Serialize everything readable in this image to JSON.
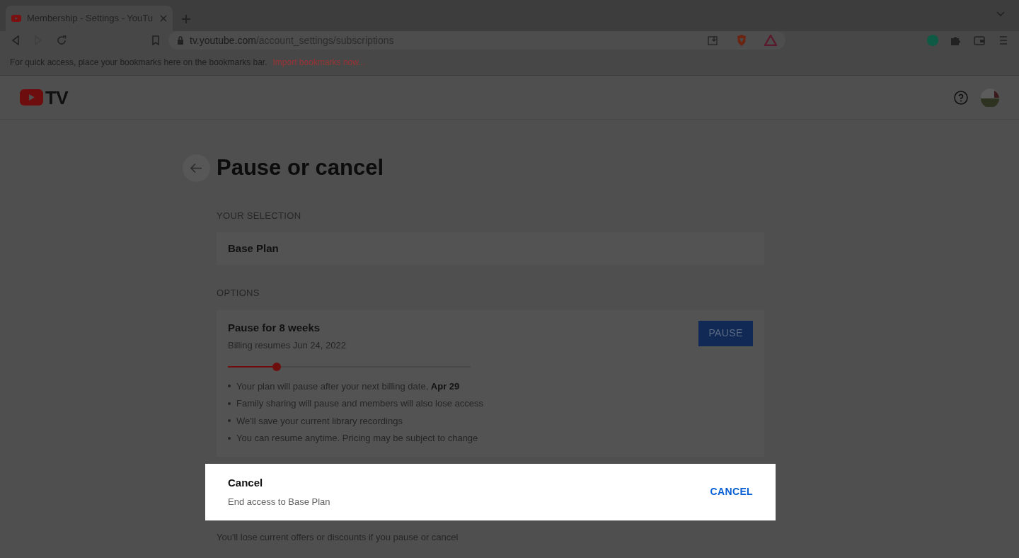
{
  "browser": {
    "tab": {
      "title": "Membership - Settings - YouTu"
    },
    "url_host": "tv.youtube.com",
    "url_path": "/account_settings/subscriptions",
    "bookmarks_hint": "For quick access, place your bookmarks here on the bookmarks bar.",
    "bookmarks_link": "Import bookmarks now..."
  },
  "header": {
    "logo_text": "TV"
  },
  "page": {
    "title": "Pause or cancel",
    "selection": {
      "label": "YOUR SELECTION",
      "value": "Base Plan"
    },
    "options": {
      "label": "OPTIONS",
      "pause": {
        "title": "Pause for 8 weeks",
        "subtitle": "Billing resumes Jun 24, 2022",
        "level": 0.2,
        "button": "PAUSE",
        "bullets": [
          "Your plan will pause after your next billing date, **Apr 29**",
          "Family sharing will pause and members will also lose access",
          "We'll save your current library recordings",
          "You can resume anytime. Pricing may be subject to change"
        ]
      },
      "cancel": {
        "title": "Cancel",
        "subtitle": "End access to Base Plan",
        "button": "CANCEL",
        "highlighted": true
      }
    },
    "note": "You'll lose current offers or discounts if you pause or cancel"
  }
}
